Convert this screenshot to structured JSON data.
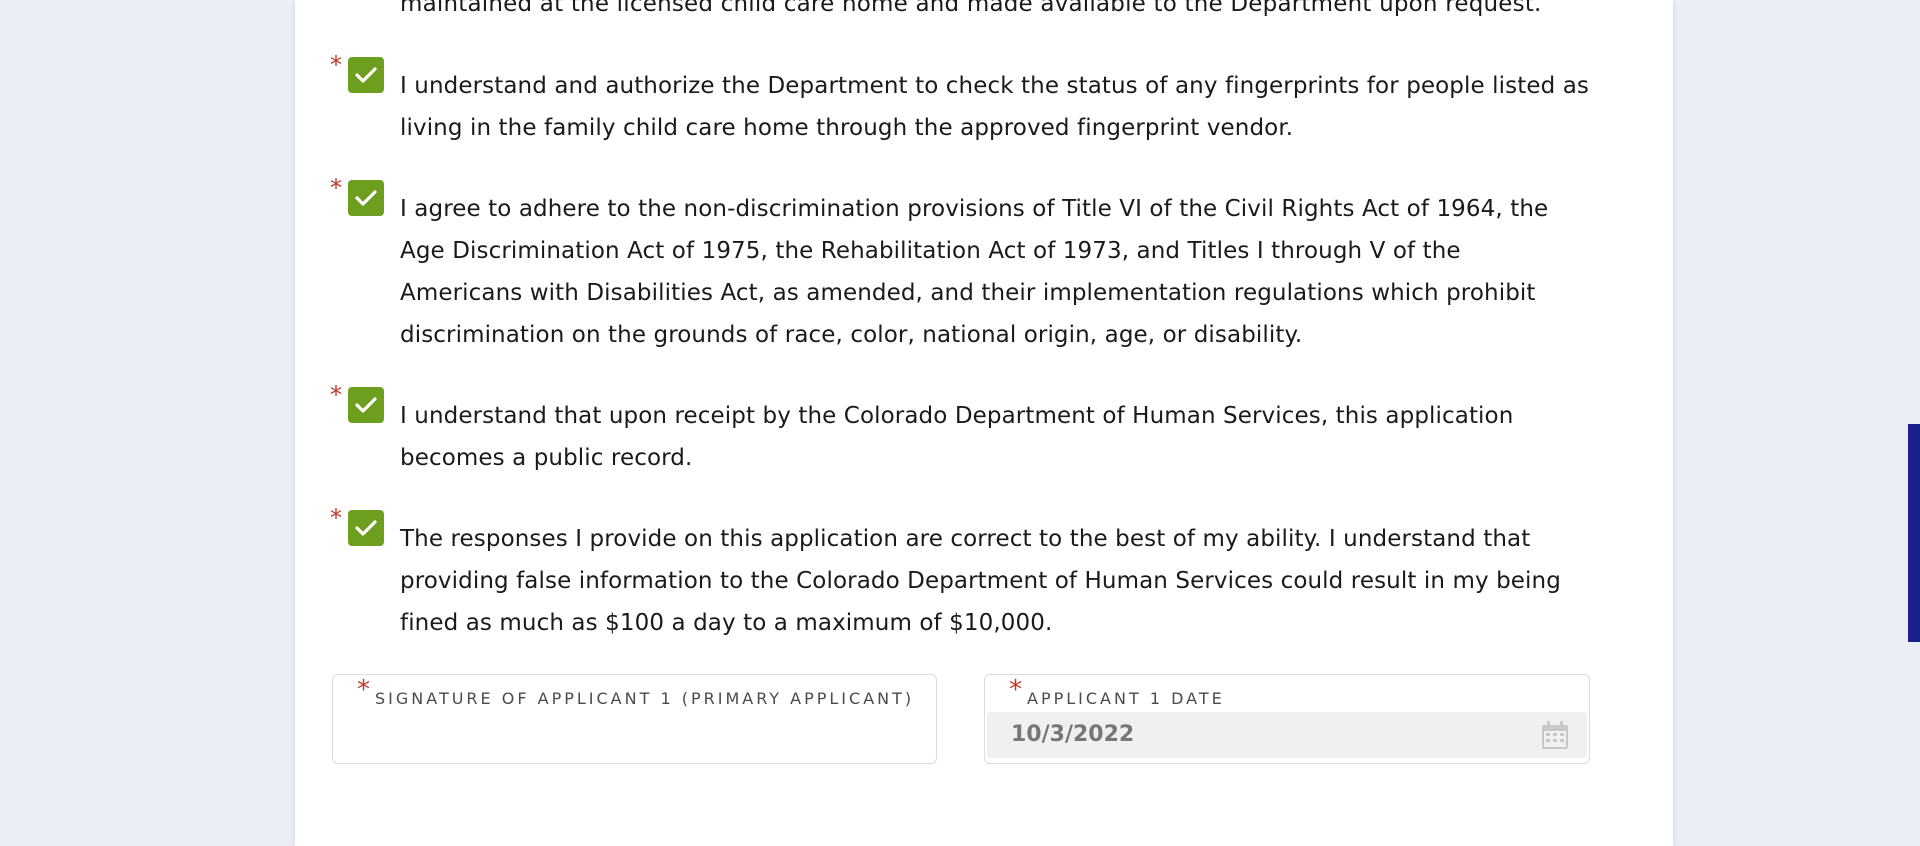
{
  "form": {
    "cutoff_text": "maintained at the licensed child care home and made available to the Department upon request.",
    "required_marker": "*",
    "acknowledgements": [
      {
        "text": "I understand and authorize the Department to check the status of any fingerprints for people listed as living in the family child care home through the approved fingerprint vendor.",
        "checked": true
      },
      {
        "text": "I agree to adhere to the non-discrimination provisions of Title VI of the Civil Rights Act of 1964, the Age Discrimination Act of 1975, the Rehabilitation Act of 1973, and Titles I through V of the Americans with Disabilities Act, as amended, and their implementation regulations which prohibit discrimination on the grounds of race, color, national origin, age, or disability.",
        "checked": true
      },
      {
        "text": "I understand that upon receipt by the Colorado Department of Human Services, this application becomes a public record.",
        "checked": true
      },
      {
        "text": "The responses I provide on this application are correct to the best of my ability. I understand that providing false information to the Colorado Department of Human Services could result in my being fined as much as $100 a day to a maximum of $10,000.",
        "checked": true
      }
    ],
    "signature": {
      "label": "SIGNATURE OF APPLICANT 1 (PRIMARY APPLICANT)",
      "value": ""
    },
    "date": {
      "label": "APPLICANT 1 DATE",
      "value": "10/3/2022",
      "icon": "calendar-icon"
    }
  },
  "colors": {
    "background": "#eceef7",
    "checkbox": "#6e9e1e",
    "required": "#c0392b",
    "scrollbar_thumb": "#1a1f8c"
  }
}
